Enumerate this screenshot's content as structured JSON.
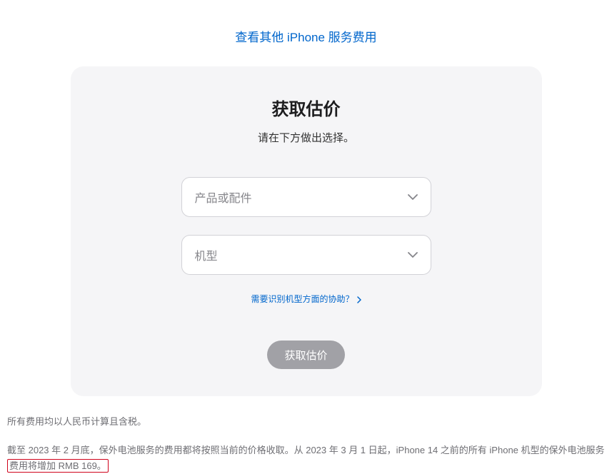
{
  "topLink": {
    "label": "查看其他 iPhone 服务费用"
  },
  "card": {
    "title": "获取估价",
    "subtitle": "请在下方做出选择。",
    "select1": {
      "placeholder": "产品或配件"
    },
    "select2": {
      "placeholder": "机型"
    },
    "helpLink": {
      "label": "需要识别机型方面的协助？"
    },
    "button": {
      "label": "获取估价"
    }
  },
  "footnotes": {
    "line1": "所有费用均以人民币计算且含税。",
    "line2_pre": "截至 2023 年 2 月底，保外电池服务的费用都将按照当前的价格收取。从 2023 年 3 月 1 日起，iPhone 14 之前的所有 iPhone 机型的保外电池服务",
    "line2_highlight": "费用将增加 RMB 169。"
  }
}
